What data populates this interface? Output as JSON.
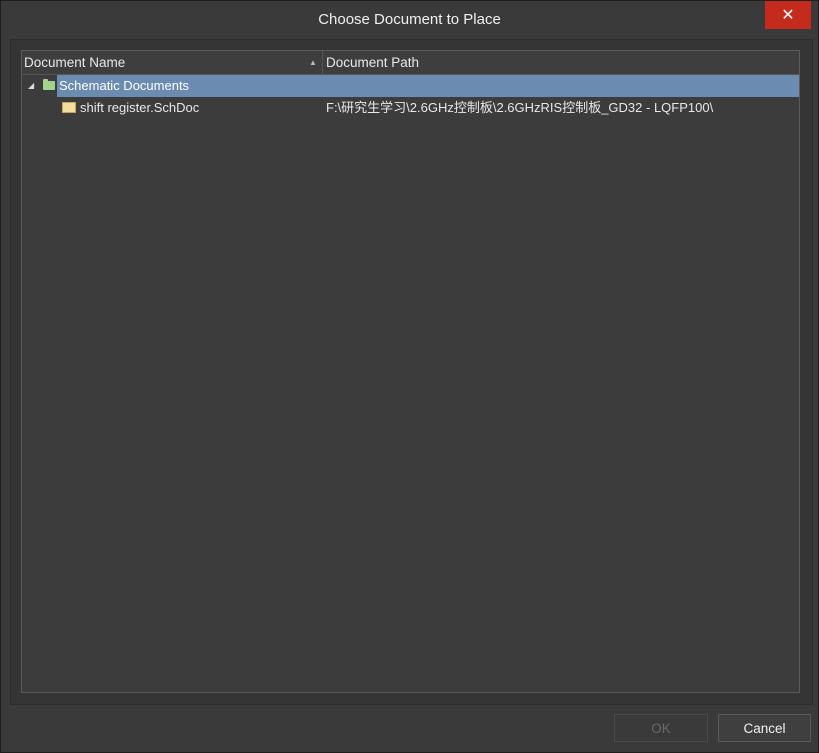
{
  "window": {
    "title": "Choose Document to Place",
    "close_icon": "✕"
  },
  "table": {
    "columns": [
      "Document Name",
      "Document Path"
    ],
    "sort_icon": "▲",
    "groups": [
      {
        "expander_icon": "◢",
        "label": "Schematic Documents",
        "items": [
          {
            "name": "shift register.SchDoc",
            "path": "F:\\研究生学习\\2.6GHz控制板\\2.6GHzRIS控制板_GD32 - LQFP100\\"
          }
        ]
      }
    ]
  },
  "buttons": {
    "ok": "OK",
    "cancel": "Cancel"
  },
  "colors": {
    "selection": "#6b8bb0",
    "close": "#c42b1c",
    "folder": "#a4d48b"
  }
}
